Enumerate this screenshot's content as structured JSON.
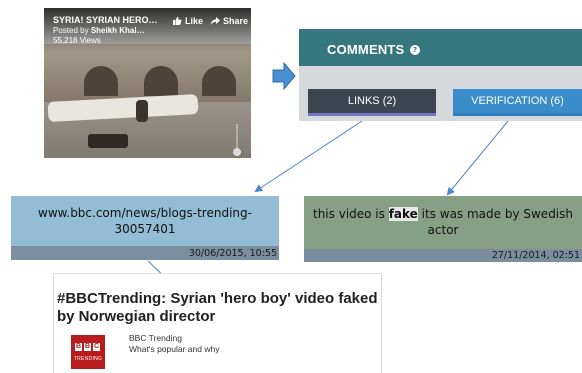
{
  "video": {
    "title": "SYRIA! SYRIAN HERO…",
    "posted_prefix": "Posted by ",
    "posted_by": "Sheikh Khal…",
    "views": "55,218 Views",
    "like_label": "Like",
    "share_label": "Share"
  },
  "comments_panel": {
    "title": "COMMENTS",
    "help_icon": "question-icon",
    "tabs": [
      {
        "label": "LINKS (2)",
        "color": "#3b4650"
      },
      {
        "label": "VERIFICATION (6)",
        "color": "#3a8ccb"
      }
    ]
  },
  "link_box": {
    "text": "www.bbc.com/news/blogs-trending-30057401",
    "date": "30/06/2015, 10:55"
  },
  "verification_box": {
    "text_before": "this video is ",
    "highlight": "fake",
    "text_after": " its was made by Swedish actor",
    "date": "27/11/2014, 02:51"
  },
  "article": {
    "title": "#BBCTrending: Syrian 'hero boy' video faked by Norwegian director",
    "logo_letters": [
      "B",
      "B",
      "C"
    ],
    "logo_sub": "TRENDING",
    "channel_name": "BBC Trending",
    "tagline": "What's popular and why"
  },
  "colors": {
    "accent_teal": "#35767f",
    "link_box": "#93bcd5",
    "verification_box": "#86a086",
    "bbc_red": "#b91c1c"
  }
}
